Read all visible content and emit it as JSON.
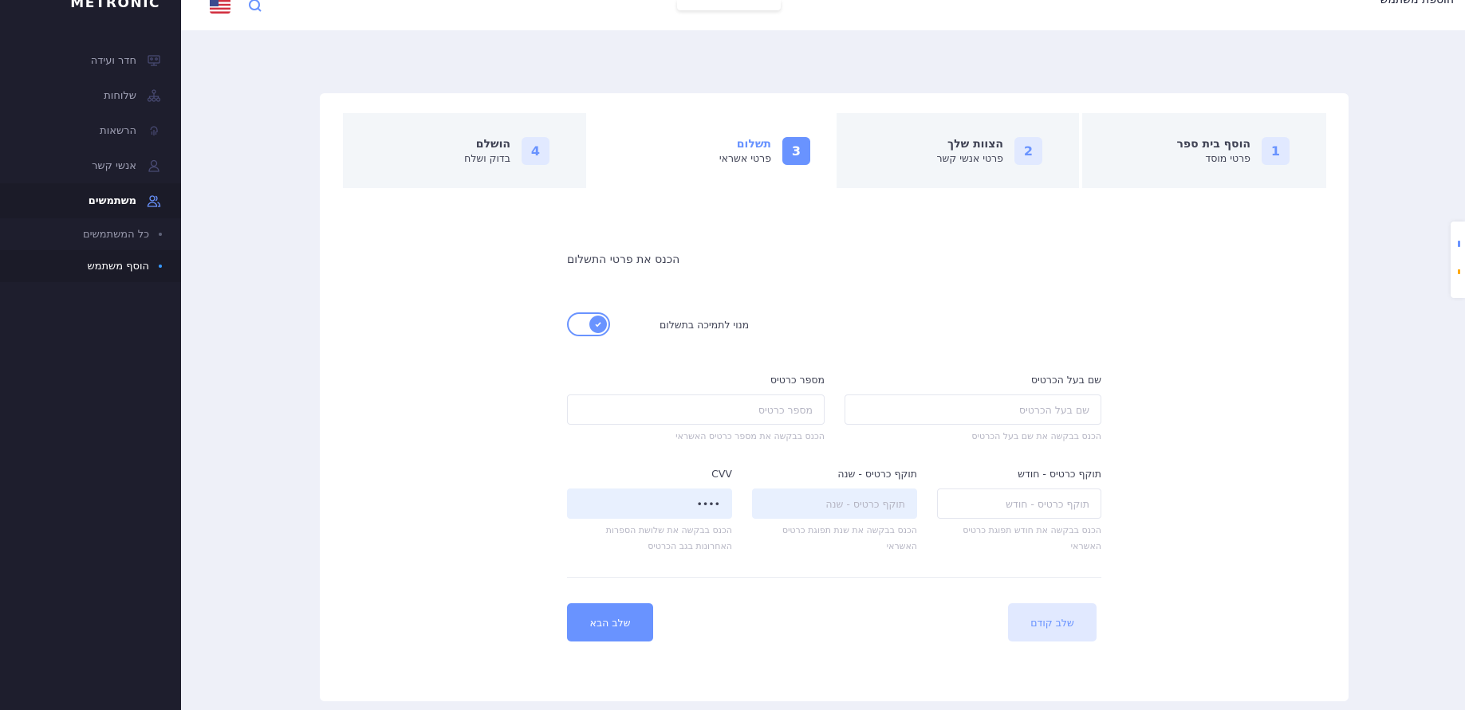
{
  "brand": {
    "name": "METRONIC"
  },
  "header": {
    "title": "הוספת משתמש"
  },
  "sidebar": {
    "items": [
      {
        "label": "חדר ועידה",
        "icon": "conference-icon"
      },
      {
        "label": "שלוחות",
        "icon": "hierarchy-icon"
      },
      {
        "label": "הרשאות",
        "icon": "fingerprint-icon"
      },
      {
        "label": "אנשי קשר",
        "icon": "contact-icon"
      },
      {
        "label": "משתמשים",
        "icon": "users-icon"
      }
    ],
    "subitems": [
      {
        "label": "כל המשתמשים"
      },
      {
        "label": "הוסף משתמש"
      }
    ]
  },
  "wizard": {
    "steps": [
      {
        "num": "1",
        "title": "הוסף בית ספר",
        "desc": "פרטי מוסד"
      },
      {
        "num": "2",
        "title": "הצוות שלך",
        "desc": "פרטי אנשי קשר"
      },
      {
        "num": "3",
        "title": "תשלום",
        "desc": "פרטי אשראי"
      },
      {
        "num": "4",
        "title": "הושלם",
        "desc": "בדוק ושלח"
      }
    ],
    "current_step": 3
  },
  "form": {
    "title": "הכנס את פרטי התשלום",
    "toggle_label": "מנוי לתמיכה בתשלום",
    "toggle_on": true,
    "card_holder": {
      "label": "שם בעל הכרטיס",
      "placeholder": "שם בעל הכרטיס",
      "hint": "הכנס בבקשה את שם בעל הכרטיס"
    },
    "card_number": {
      "label": "מספר כרטיס",
      "placeholder": "מספר כרטיס",
      "hint": "הכנס בבקשה את מספר כרטיס האשראי"
    },
    "exp_month": {
      "label": "תוקף כרטיס - חודש",
      "placeholder": "תוקף כרטיס - חודש",
      "hint": "הכנס בבקשה את חודש תפוגת כרטיס האשראי"
    },
    "exp_year": {
      "label": "תוקף כרטיס - שנה",
      "placeholder": "תוקף כרטיס - שנה",
      "hint": "הכנס בבקשה את שנת תפוגת כרטיס האשראי"
    },
    "cvv": {
      "label": "CVV",
      "value": "••••",
      "hint": "הכנס בבקשה את שלושת הספרות האחרונות בגב הכרטיס"
    },
    "next_label": "שלב הבא",
    "prev_label": "שלב קודם"
  },
  "colors": {
    "primary": "#6993ff",
    "sidebar": "#1e1e2d",
    "background": "#eef0f8"
  }
}
